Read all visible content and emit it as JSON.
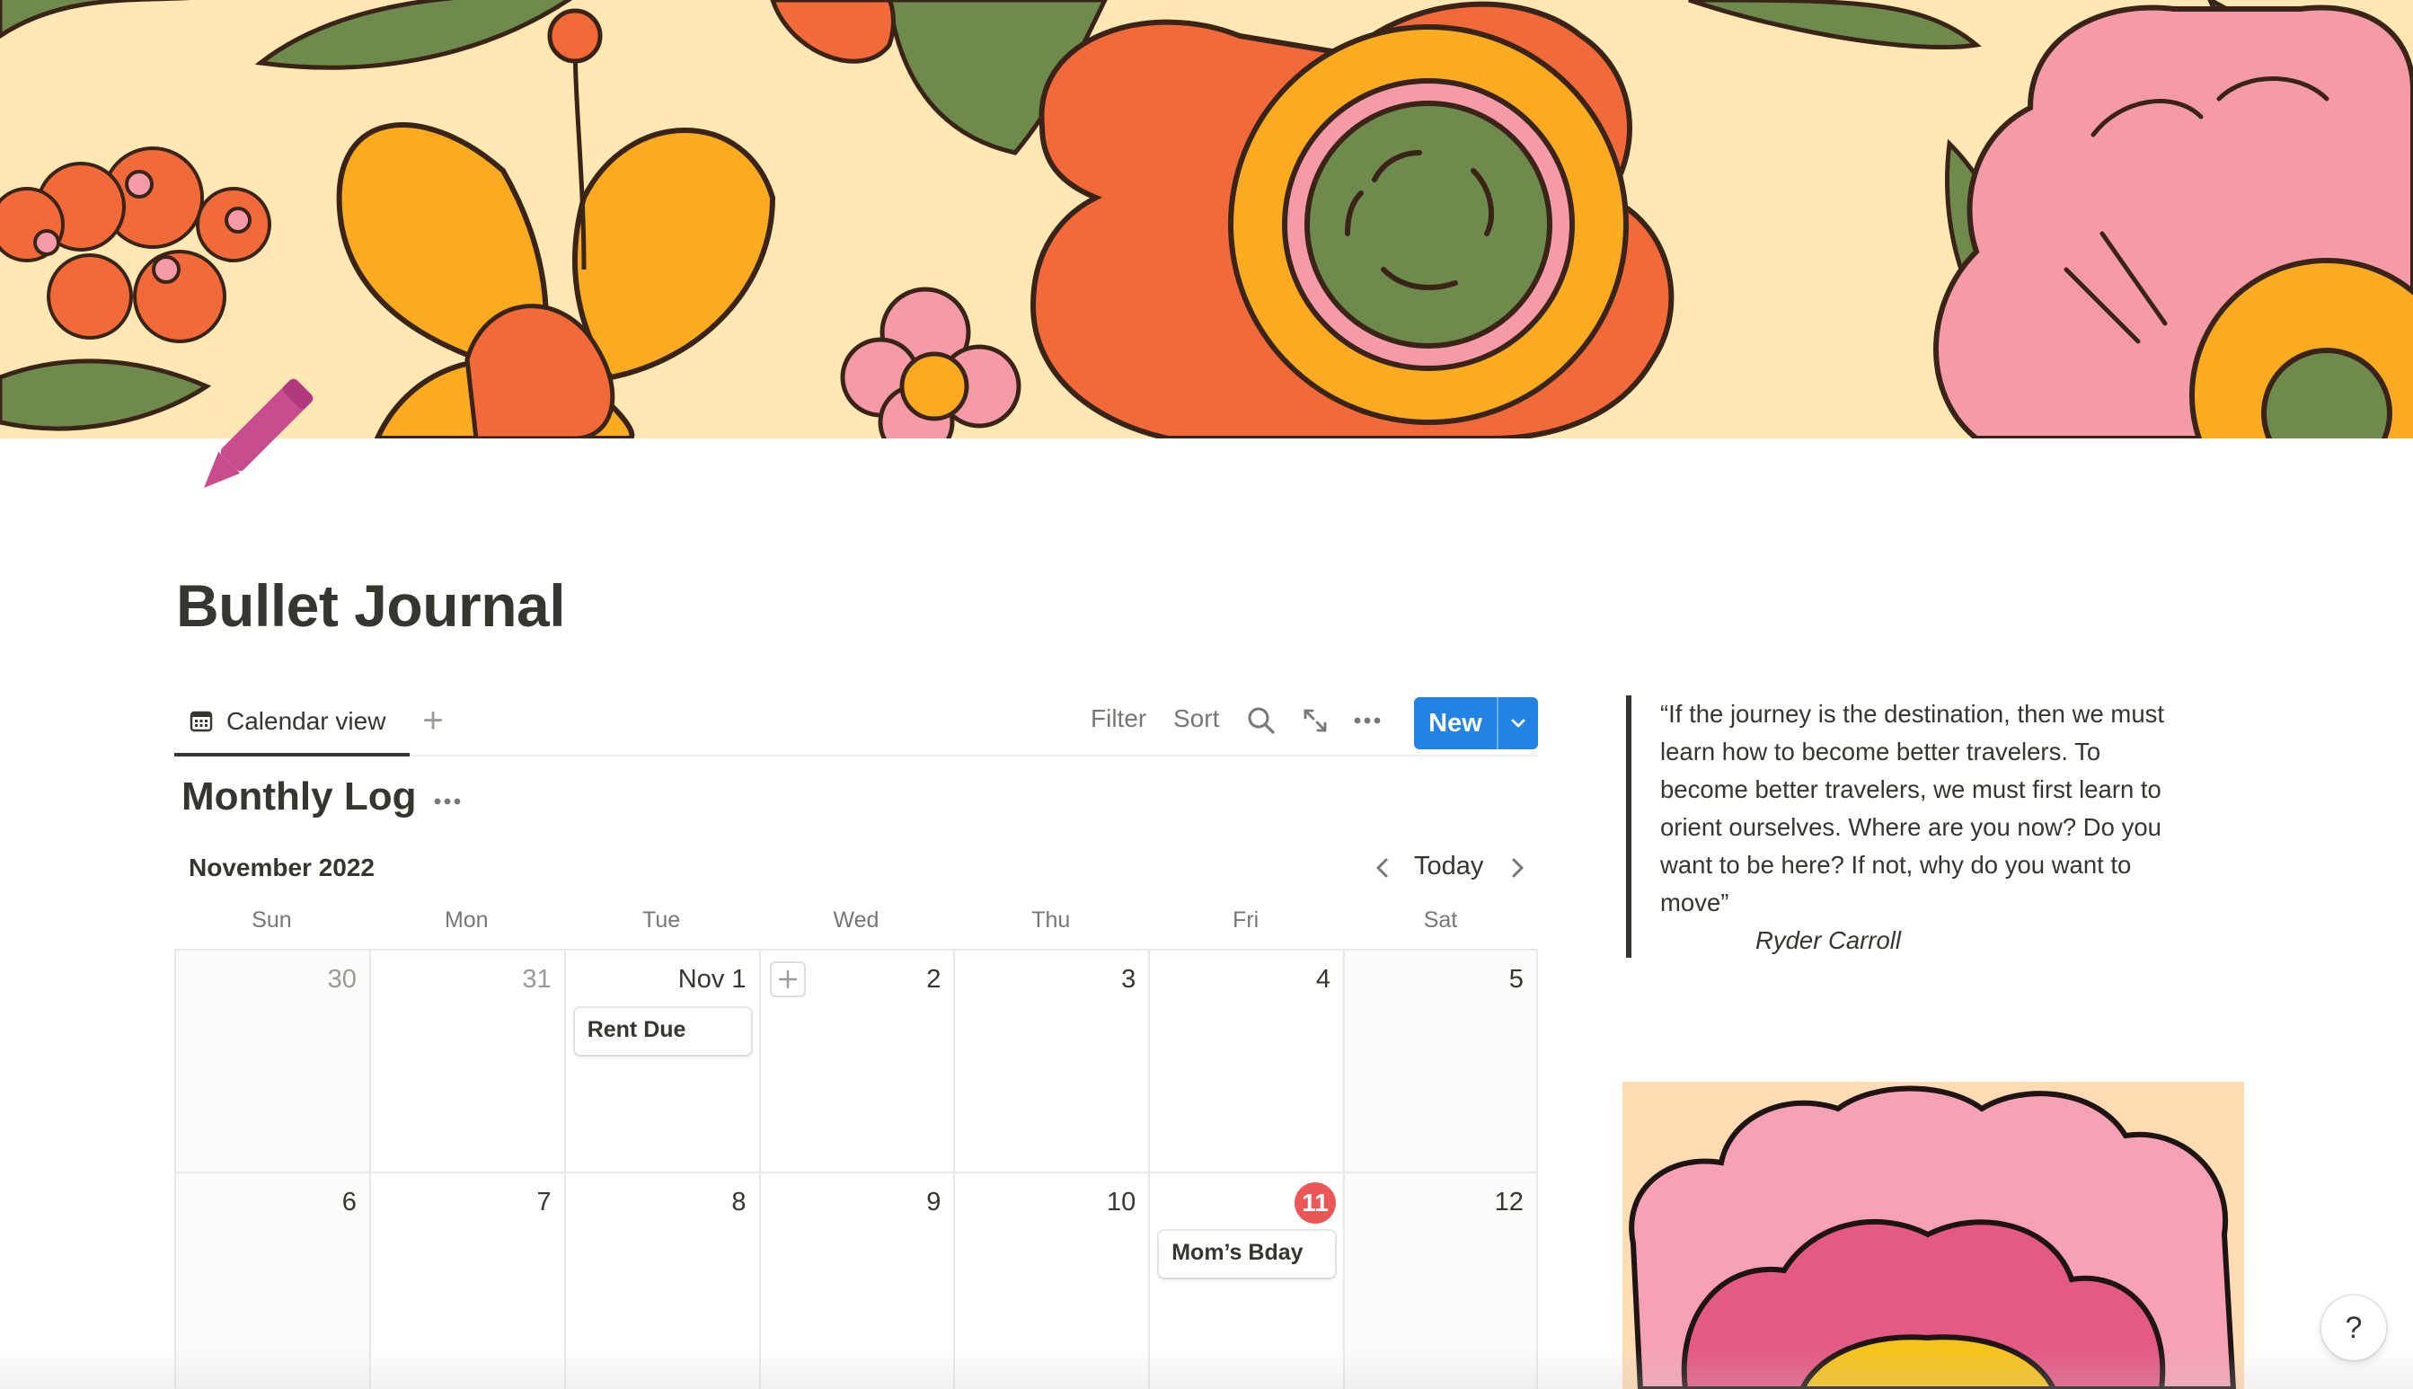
{
  "page": {
    "title": "Bullet Journal",
    "cover_image": "retro-flowers-cover",
    "page_icon": "pencil-icon",
    "icon_color": "#c94c8f"
  },
  "views": {
    "active_tab": "Calendar view",
    "add_view_label": "+"
  },
  "toolbar": {
    "filter_label": "Filter",
    "sort_label": "Sort",
    "search_icon": "search-icon",
    "expand_icon": "expand-icon",
    "more_icon": "more-icon",
    "new_label": "New",
    "new_color": "#2383e2"
  },
  "calendar": {
    "title": "Monthly Log",
    "month_label": "November 2022",
    "today_label": "Today",
    "weekdays": [
      "Sun",
      "Mon",
      "Tue",
      "Wed",
      "Thu",
      "Fri",
      "Sat"
    ],
    "weeks": [
      [
        {
          "label": "30",
          "muted": true
        },
        {
          "label": "31",
          "muted": true
        },
        {
          "label": "Nov 1",
          "event": "Rent Due"
        },
        {
          "label": "2",
          "add_button": true
        },
        {
          "label": "3"
        },
        {
          "label": "4"
        },
        {
          "label": "5"
        }
      ],
      [
        {
          "label": "6"
        },
        {
          "label": "7"
        },
        {
          "label": "8"
        },
        {
          "label": "9"
        },
        {
          "label": "10"
        },
        {
          "label": "11",
          "today": true,
          "event": "Mom’s Bday"
        },
        {
          "label": "12"
        }
      ]
    ],
    "today_color": "#eb5757"
  },
  "quote": {
    "lines": [
      "“If the journey is the destination, then we must",
      "learn how to become better travelers. To",
      "become better travelers, we must first learn to",
      "orient ourselves. Where are you now? Do you",
      "want to be here? If not, why do you want to",
      "move”"
    ],
    "author": "Ryder Carroll"
  },
  "side_image": "pink-flower-illustration",
  "help": {
    "label": "?"
  }
}
